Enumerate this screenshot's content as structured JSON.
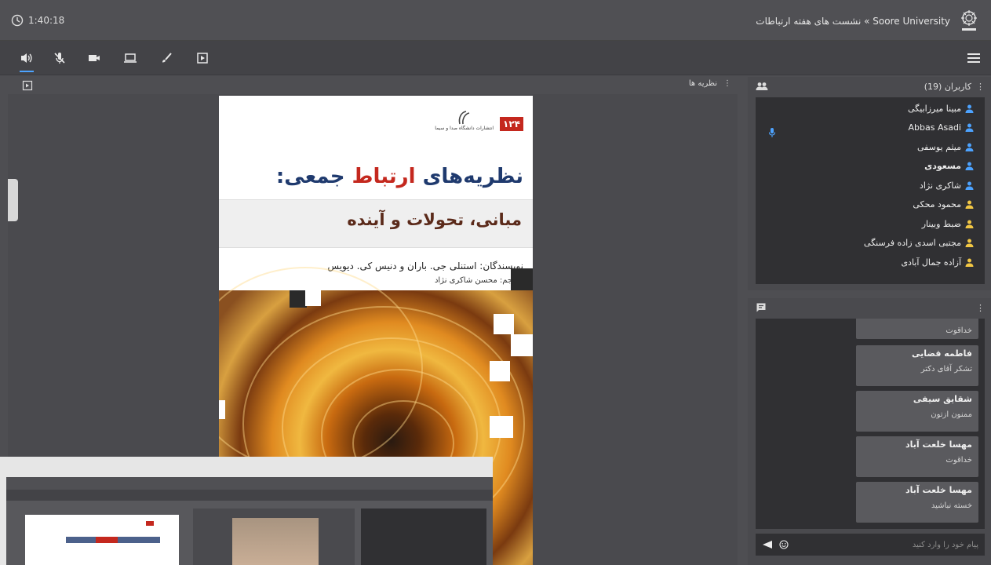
{
  "header": {
    "clock": "1:40:18",
    "title": "Soore University » نشست های هفته ارتباطات"
  },
  "toolbar": {
    "buttons": [
      "speaker-icon",
      "mic-muted-icon",
      "camera-icon",
      "screen-share-icon",
      "brush-icon",
      "presentation-icon"
    ]
  },
  "presentation": {
    "title": "نظریه ها"
  },
  "book": {
    "series_number": "۱۲۴",
    "publisher": "انتشارات دانشگاه صدا و سیما",
    "title_part1": "نظریه‌های ",
    "title_red": "ارتباط",
    "title_part2": " جمعی:",
    "subtitle": "مبانی، تحولات و آینده",
    "authors": "نویسندگان: استنلی جی. باران و دنیس کی. دیویس",
    "translator": "مترجم: محسن شاکری نژاد"
  },
  "users": {
    "title": "کاربران (19)",
    "items": [
      {
        "name": "مبینا میرزابیگی",
        "bold": false,
        "color": "#4da3ff"
      },
      {
        "name": "Abbas Asadi",
        "bold": false,
        "color": "#4da3ff"
      },
      {
        "name": "میثم یوسفی",
        "bold": false,
        "color": "#4da3ff"
      },
      {
        "name": "مسعودی",
        "bold": true,
        "color": "#4da3ff"
      },
      {
        "name": "شاکری نژاد",
        "bold": false,
        "color": "#4da3ff"
      },
      {
        "name": "محمود محکی",
        "bold": false,
        "color": "#f2c744"
      },
      {
        "name": "ضبط وبینار",
        "bold": false,
        "color": "#f2c744"
      },
      {
        "name": "مجتبی اسدی زاده فرسنگی",
        "bold": false,
        "color": "#f2c744"
      },
      {
        "name": "آزاده جمال آبادی",
        "bold": false,
        "color": "#f2c744"
      }
    ]
  },
  "chat": {
    "messages": [
      {
        "sender": "",
        "text": "خداقوت"
      },
      {
        "sender": "فاطمه قضایی",
        "text": "تشکر آقای دکتر"
      },
      {
        "sender": "شقایق سیفی",
        "text": "ممنون ازتون"
      },
      {
        "sender": "مهسا خلعت آباد",
        "text": "خداقوت"
      },
      {
        "sender": "مهسا خلعت آباد",
        "text": "خسته نباشید"
      }
    ],
    "input_placeholder": "پیام خود را وارد کنید"
  },
  "colors": {
    "accent": "#4da3ff",
    "moderator": "#f2c744",
    "book_red": "#c4281e",
    "book_blue": "#1f3a6e"
  }
}
